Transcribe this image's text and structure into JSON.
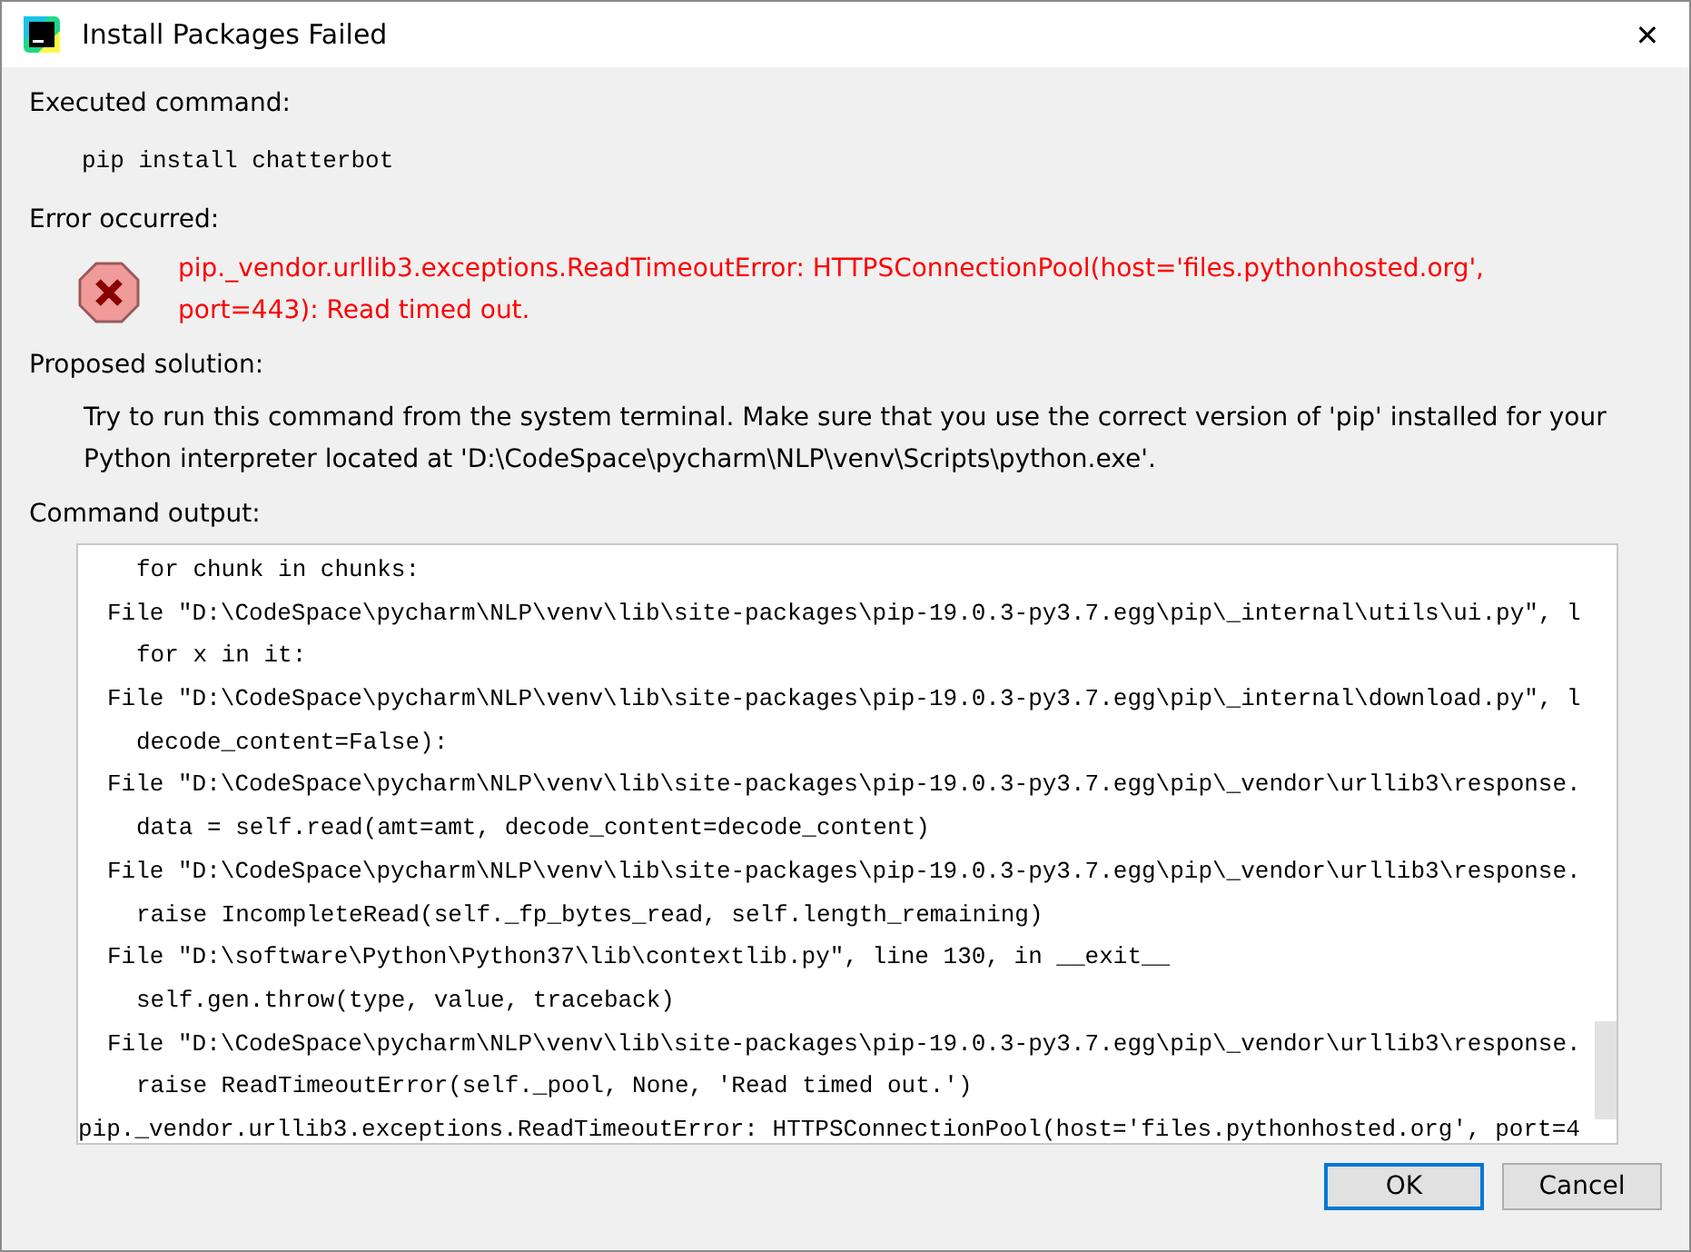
{
  "window": {
    "title": "Install Packages Failed",
    "close": "✕"
  },
  "executed": {
    "label": "Executed command:",
    "command": "pip install chatterbot"
  },
  "error": {
    "label": "Error occurred:",
    "message": "pip._vendor.urllib3.exceptions.ReadTimeoutError: HTTPSConnectionPool(host='files.pythonhosted.org', port=443): Read timed out."
  },
  "solution": {
    "label": "Proposed solution:",
    "text": "Try to run this command from the system terminal. Make sure that you use the correct version of 'pip' installed for your Python interpreter located at 'D:\\CodeSpace\\pycharm\\NLP\\venv\\Scripts\\python.exe'."
  },
  "output": {
    "label": "Command output:",
    "lines": [
      {
        "kind": "code",
        "text": "for chunk in chunks:"
      },
      {
        "kind": "frame",
        "text": "File \"D:\\CodeSpace\\pycharm\\NLP\\venv\\lib\\site-packages\\pip-19.0.3-py3.7.egg\\pip\\_internal\\utils\\ui.py\", l"
      },
      {
        "kind": "code",
        "text": "for x in it:"
      },
      {
        "kind": "frame",
        "text": "File \"D:\\CodeSpace\\pycharm\\NLP\\venv\\lib\\site-packages\\pip-19.0.3-py3.7.egg\\pip\\_internal\\download.py\", l"
      },
      {
        "kind": "code",
        "text": "decode_content=False):"
      },
      {
        "kind": "frame",
        "text": "File \"D:\\CodeSpace\\pycharm\\NLP\\venv\\lib\\site-packages\\pip-19.0.3-py3.7.egg\\pip\\_vendor\\urllib3\\response."
      },
      {
        "kind": "code",
        "text": "data = self.read(amt=amt, decode_content=decode_content)"
      },
      {
        "kind": "frame",
        "text": "File \"D:\\CodeSpace\\pycharm\\NLP\\venv\\lib\\site-packages\\pip-19.0.3-py3.7.egg\\pip\\_vendor\\urllib3\\response."
      },
      {
        "kind": "code",
        "text": "raise IncompleteRead(self._fp_bytes_read, self.length_remaining)"
      },
      {
        "kind": "frame",
        "text": "File \"D:\\software\\Python\\Python37\\lib\\contextlib.py\", line 130, in __exit__"
      },
      {
        "kind": "code",
        "text": "self.gen.throw(type, value, traceback)"
      },
      {
        "kind": "frame",
        "text": "File \"D:\\CodeSpace\\pycharm\\NLP\\venv\\lib\\site-packages\\pip-19.0.3-py3.7.egg\\pip\\_vendor\\urllib3\\response."
      },
      {
        "kind": "code",
        "text": "raise ReadTimeoutError(self._pool, None, 'Read timed out.')"
      },
      {
        "kind": "error",
        "text": "pip._vendor.urllib3.exceptions.ReadTimeoutError: HTTPSConnectionPool(host='files.pythonhosted.org', port=4"
      }
    ]
  },
  "buttons": [
    {
      "label": "OK",
      "selected": true
    },
    {
      "label": "Cancel",
      "selected": false
    }
  ]
}
